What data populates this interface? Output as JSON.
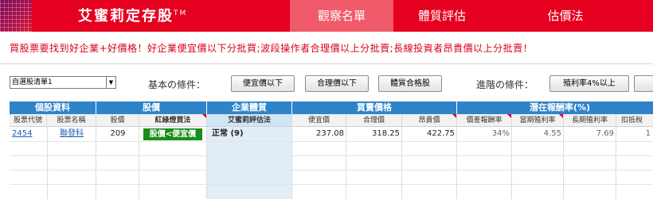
{
  "header": {
    "brand": "艾蜜莉定存股",
    "brand_tm": "TM",
    "tabs": [
      {
        "label": "觀察名單",
        "active": true
      },
      {
        "label": "體質評估",
        "active": false
      },
      {
        "label": "估價法",
        "active": false
      }
    ]
  },
  "slogan": "買股票要找到好企業+好價格！好企業便宜價以下分批買;波段操作者合理價以上分批賣;長線投資者昂貴價以上分批賣！",
  "filter": {
    "watchlist_select": "自選股清單1",
    "basic_label": "基本の條件：",
    "basic_buttons": [
      "便宜價以下",
      "合理價以下",
      "體質合格股"
    ],
    "advanced_label": "進階の條件：",
    "advanced_buttons": [
      "殖利率4%以上"
    ]
  },
  "table": {
    "groups": [
      "個股資料",
      "股價",
      "企業體質",
      "買賣價格",
      "潛在報酬率(%)"
    ],
    "columns": [
      "股票代號",
      "股票名稱",
      "股價",
      "紅綠燈買法",
      "艾蜜莉評估法",
      "便宜價",
      "合理價",
      "昂貴價",
      "價差報酬率",
      "當期殖利率",
      "長期殖利率",
      "扣抵稅"
    ],
    "rows": [
      {
        "code": "2454",
        "name": "聯發科",
        "price": "209",
        "signal": "股價<便宜價",
        "health": "正常 (9)",
        "cheap": "237.08",
        "fair": "318.25",
        "expensive": "422.75",
        "spread_return": "34%",
        "current_yield": "4.55",
        "long_yield": "7.69",
        "tax_credit": "1"
      }
    ]
  },
  "colors": {
    "header_red": "#e60020",
    "active_tab": "#f05a6a",
    "table_header_blue": "#2f84c9",
    "signal_green": "#1a8d1a"
  }
}
